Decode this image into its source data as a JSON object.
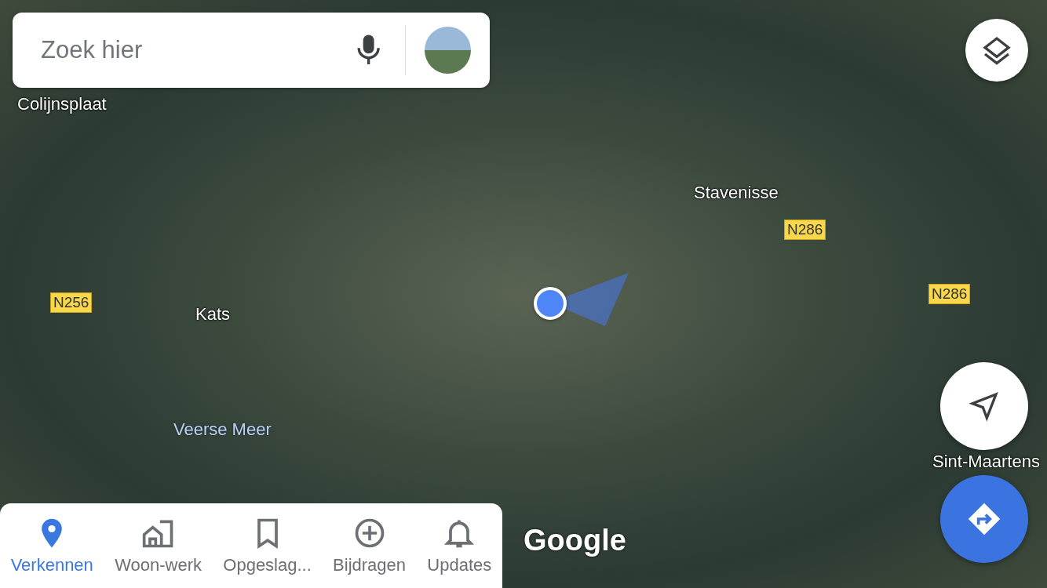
{
  "search": {
    "placeholder": "Zoek hier"
  },
  "map_labels": [
    {
      "kind": "place",
      "text": "Colijnsplaat"
    },
    {
      "kind": "place",
      "text": "Stavenisse"
    },
    {
      "kind": "road",
      "text": "N286"
    },
    {
      "kind": "road",
      "text": "N286"
    },
    {
      "kind": "road",
      "text": "N256"
    },
    {
      "kind": "place",
      "text": "Kats"
    },
    {
      "kind": "water",
      "text": "Veerse Meer"
    },
    {
      "kind": "place",
      "text": "Sint-Maartens"
    }
  ],
  "logo": "Google",
  "tabs": [
    {
      "label": "Verkennen",
      "kind": "pin",
      "selected": true
    },
    {
      "label": "Woon-werk",
      "kind": "commute",
      "selected": false
    },
    {
      "label": "Opgeslag...",
      "kind": "bookmark",
      "selected": false
    },
    {
      "label": "Bijdragen",
      "kind": "add",
      "selected": false
    },
    {
      "label": "Updates",
      "kind": "bell",
      "selected": false
    }
  ]
}
